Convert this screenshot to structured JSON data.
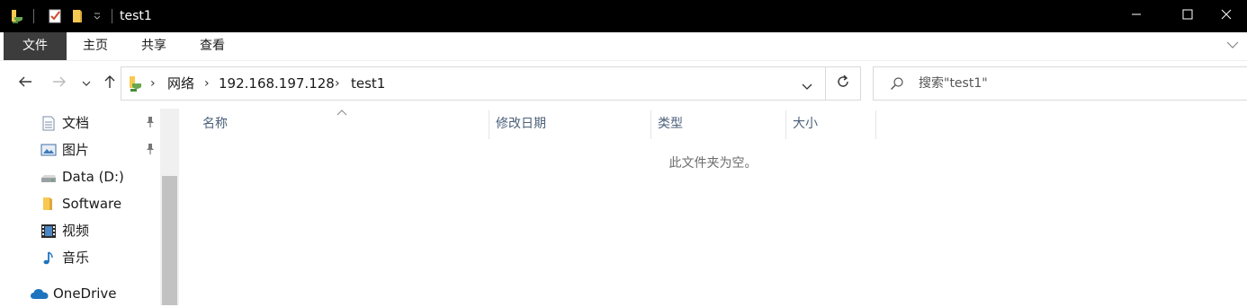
{
  "window": {
    "title": "test1",
    "icons": {
      "quick_access": [
        "folder-icon",
        "properties-icon",
        "new-folder-icon",
        "customize-dropdown-icon"
      ],
      "controls": [
        "minimize-icon",
        "maximize-icon",
        "close-icon"
      ]
    }
  },
  "ribbon": {
    "tabs": [
      {
        "label": "文件",
        "active": true
      },
      {
        "label": "主页",
        "active": false
      },
      {
        "label": "共享",
        "active": false
      },
      {
        "label": "查看",
        "active": false
      }
    ]
  },
  "address": {
    "breadcrumbs": [
      "网络",
      "192.168.197.128",
      "test1"
    ],
    "search_placeholder": "搜索\"test1\""
  },
  "navpane": {
    "items": [
      {
        "label": "文档",
        "icon": "documents-icon",
        "pinned": true
      },
      {
        "label": "图片",
        "icon": "pictures-icon",
        "pinned": true
      },
      {
        "label": "Data (D:)",
        "icon": "drive-icon",
        "pinned": false
      },
      {
        "label": "Software",
        "icon": "folder-icon",
        "pinned": false
      },
      {
        "label": "视频",
        "icon": "videos-icon",
        "pinned": false
      },
      {
        "label": "音乐",
        "icon": "music-icon",
        "pinned": false
      },
      {
        "label": "OneDrive",
        "icon": "onedrive-icon",
        "pinned": false
      }
    ]
  },
  "content": {
    "columns": [
      "名称",
      "修改日期",
      "类型",
      "大小"
    ],
    "sorted_column": "名称",
    "empty_message": "此文件夹为空。"
  },
  "colors": {
    "titlebar_bg": "#000000",
    "active_tab_bg": "#3c3c3c",
    "folder_yellow": "#f8c951",
    "column_header_text": "#4c607a",
    "scrollbar_thumb": "#c2c2c2"
  }
}
